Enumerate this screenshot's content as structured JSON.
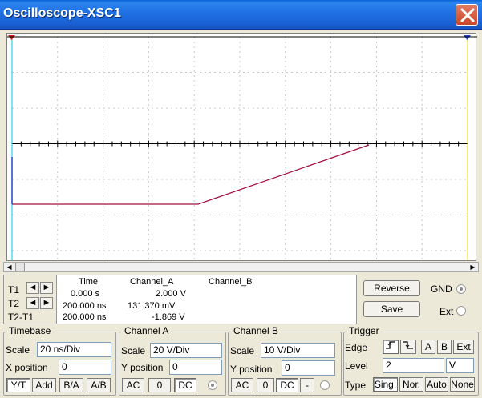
{
  "window": {
    "title": "Oscilloscope-XSC1"
  },
  "cursors": {
    "rows": [
      "T1",
      "T2",
      "T2-T1"
    ],
    "headers": {
      "time": "Time",
      "channel_a": "Channel_A",
      "channel_b": "Channel_B"
    },
    "t1": {
      "time": "0.000 s",
      "channel_a": "2.000 V",
      "channel_b": ""
    },
    "t2": {
      "time": "200.000 ns",
      "channel_a": "131.370 mV",
      "channel_b": ""
    },
    "t2t1": {
      "time": "200.000 ns",
      "channel_a": "-1.869 V",
      "channel_b": ""
    }
  },
  "buttons": {
    "reverse": "Reverse",
    "save": "Save"
  },
  "ground": {
    "gnd_label": "GND",
    "ext_label": "Ext"
  },
  "timebase": {
    "title": "Timebase",
    "scale_label": "Scale",
    "scale_value": "20 ns/Div",
    "xpos_label": "X position",
    "xpos_value": "0",
    "modes": [
      "Y/T",
      "Add",
      "B/A",
      "A/B"
    ],
    "active_mode": "Y/T"
  },
  "channel_a": {
    "title": "Channel A",
    "scale_label": "Scale",
    "scale_value": "20  V/Div",
    "ypos_label": "Y position",
    "ypos_value": "0",
    "coupling": [
      "AC",
      "0",
      "DC"
    ],
    "active_coupling": "DC"
  },
  "channel_b": {
    "title": "Channel B",
    "scale_label": "Scale",
    "scale_value": "10  V/Div",
    "ypos_label": "Y position",
    "ypos_value": "0",
    "coupling": [
      "AC",
      "0",
      "DC",
      "-"
    ],
    "active_coupling": "DC"
  },
  "trigger": {
    "title": "Trigger",
    "edge_label": "Edge",
    "edge_buttons": [
      "A",
      "B",
      "Ext"
    ],
    "level_label": "Level",
    "level_value": "2",
    "level_unit": "V",
    "type_label": "Type",
    "types": [
      "Sing.",
      "Nor.",
      "Auto",
      "None"
    ],
    "active_type": "Sing."
  },
  "colors": {
    "trace_a": "#a0103c",
    "trace_b": "#2244cc",
    "cursor1": "#00c8e8",
    "cursor2": "#f0d800"
  },
  "icons": {
    "close": "close-icon",
    "cursor_left": "arrow-left-icon",
    "cursor_right": "arrow-right-icon",
    "edge_rising": "rising-edge-icon",
    "edge_falling": "falling-edge-icon"
  }
}
